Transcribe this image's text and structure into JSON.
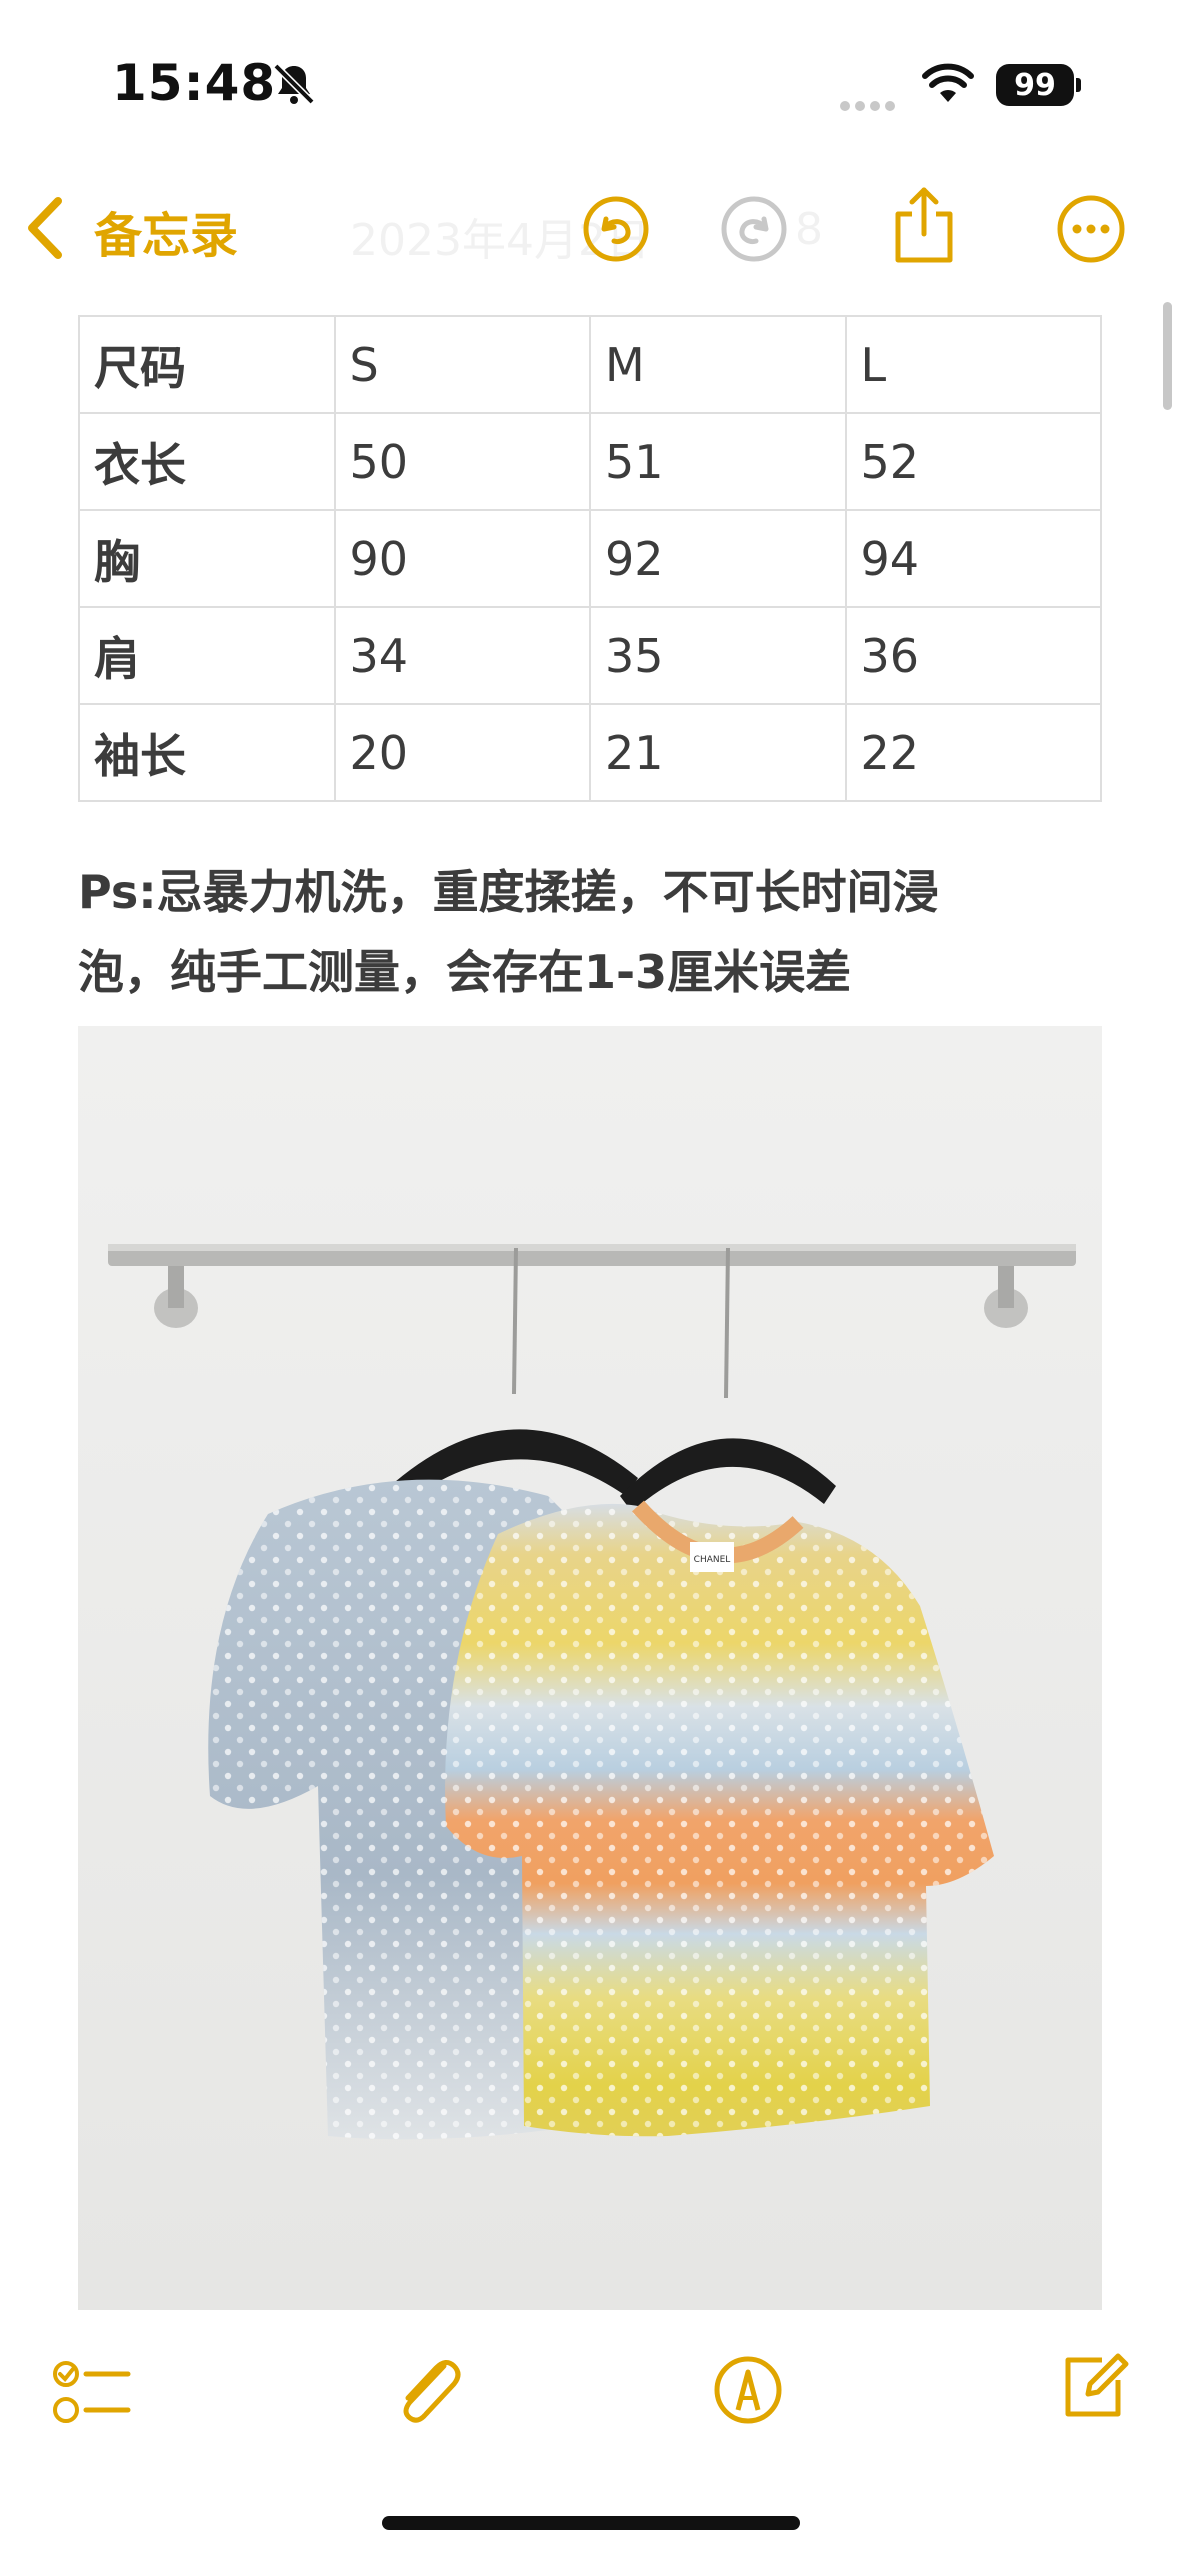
{
  "status_bar": {
    "time": "15:48",
    "battery": "99",
    "icons": [
      "bell-slash-icon",
      "signal-dots-icon",
      "wifi-icon",
      "battery-icon"
    ]
  },
  "nav": {
    "back_label": "备忘录",
    "ghost_title": "2023年4月2日",
    "ghost_subtitle": "8",
    "icons": [
      "chevron-left-icon",
      "undo-icon",
      "redo-icon",
      "share-icon",
      "more-icon"
    ]
  },
  "size_table": {
    "header": [
      "尺码",
      "S",
      "M",
      "L"
    ],
    "rows": [
      [
        "衣长",
        "50",
        "51",
        "52"
      ],
      [
        "胸",
        "90",
        "92",
        "94"
      ],
      [
        "肩",
        "34",
        "35",
        "36"
      ],
      [
        "袖长",
        "20",
        "21",
        "22"
      ]
    ]
  },
  "note": {
    "line1": "Ps:忌暴力机洗，重度揉搓，不可长时间浸",
    "line2": "泡，纯手工测量，会存在1-3厘米误差"
  },
  "photo": {
    "label_tag": "CHANEL"
  },
  "toolbar": {
    "icons": [
      "checklist-icon",
      "paperclip-icon",
      "markup-pen-icon",
      "compose-icon"
    ]
  },
  "colors": {
    "accent": "#e0a500",
    "text": "#3c3c3c",
    "grid": "#dedede"
  }
}
